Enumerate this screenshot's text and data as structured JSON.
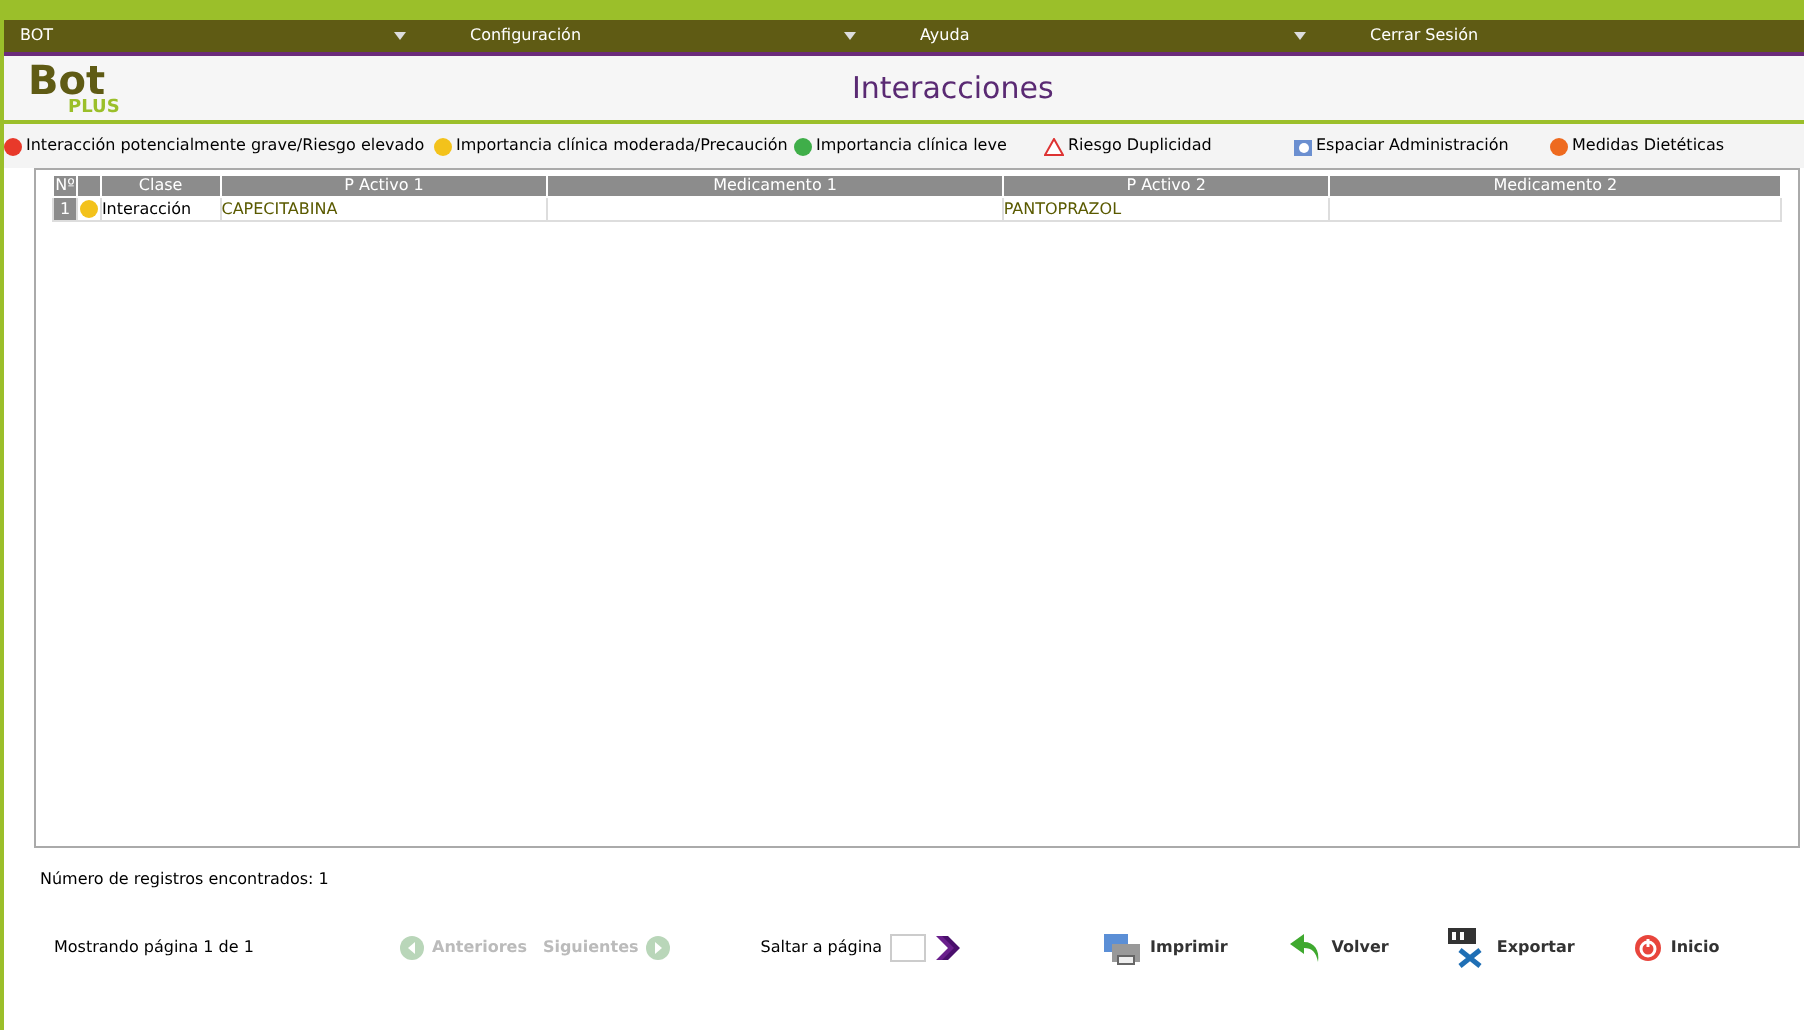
{
  "menu": [
    {
      "label": "BOT"
    },
    {
      "label": "Configuración"
    },
    {
      "label": "Ayuda"
    },
    {
      "label": "Cerrar Sesión"
    }
  ],
  "logo": {
    "main": "Bot",
    "sub": "PLUS"
  },
  "title": "Interacciones",
  "legend": [
    {
      "kind": "dot",
      "color": "#e8392a",
      "label": "Interacción potencialmente grave/Riesgo elevado"
    },
    {
      "kind": "dot",
      "color": "#f3c21b",
      "label": "Importancia clínica moderada/Precaución"
    },
    {
      "kind": "dot",
      "color": "#3fae49",
      "label": "Importancia clínica leve"
    },
    {
      "kind": "warning",
      "label": "Riesgo Duplicidad"
    },
    {
      "kind": "schedule",
      "label": "Espaciar Administración"
    },
    {
      "kind": "dot",
      "color": "#ee6a1f",
      "label": "Medidas Dietéticas"
    }
  ],
  "table": {
    "columns": [
      "Nº",
      "",
      "Clase",
      "P Activo 1",
      "Medicamento 1",
      "P Activo 2",
      "Medicamento 2"
    ],
    "rows": [
      {
        "number": "1",
        "color": "#f3c21b",
        "clase": "Interacción",
        "p_activo_1": "CAPECITABINA",
        "medicamento_1": "",
        "p_activo_2": "PANTOPRAZOL",
        "medicamento_2": ""
      }
    ]
  },
  "records": "Número de registros encontrados: 1",
  "pagination": {
    "showing": "Mostrando página 1 de 1",
    "previous": {
      "label": "Anteriores",
      "disabled": true
    },
    "next": {
      "label": "Siguientes",
      "disabled": true
    },
    "jump_label": "Saltar a página"
  },
  "actions": [
    {
      "kind": "print",
      "label": "Imprimir"
    },
    {
      "kind": "back",
      "label": "Volver"
    },
    {
      "kind": "export",
      "label": "Exportar"
    },
    {
      "kind": "home",
      "label": "Inicio"
    }
  ]
}
